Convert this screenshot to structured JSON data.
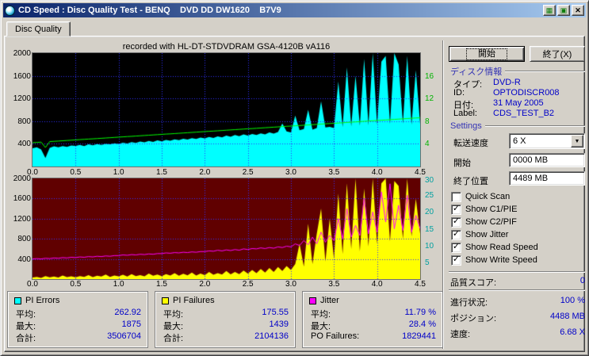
{
  "window": {
    "title": "CD Speed : Disc Quality Test - BENQ    DVD DD DW1620    B7V9",
    "buttons": [
      {
        "name": "grid-icon",
        "glyph": "▦"
      },
      {
        "name": "disc-icon",
        "glyph": "▣"
      },
      {
        "name": "close-icon",
        "glyph": "✕"
      }
    ]
  },
  "tabs": {
    "disc_quality": "Disc Quality"
  },
  "colors": {
    "window_bg": "#d4d0c8",
    "titlebar_left": "#0a246a",
    "titlebar_right": "#a6caf0",
    "value": "#0000c8",
    "header": "#3434b4"
  },
  "buttons": {
    "start": "開始",
    "exit": "終了(X)"
  },
  "disc_info": {
    "header": "ディスク情報",
    "type_label": "タイプ:",
    "type": "DVD-R",
    "id_label": "ID:",
    "id": "OPTODISCR008",
    "date_label": "日付:",
    "date": "31 May 2005",
    "label_label": "Label:",
    "label": "CDS_TEST_B2"
  },
  "settings": {
    "header": "Settings",
    "speed_label": "転送速度",
    "speed_value": "6 X",
    "start_label": "開始",
    "start_value": "0000 MB",
    "end_label": "終了位置",
    "end_value": "4489 MB",
    "checkboxes": [
      {
        "label": "Quick Scan",
        "checked": false
      },
      {
        "label": "Show C1/PIE",
        "checked": true
      },
      {
        "label": "Show C2/PIF",
        "checked": true
      },
      {
        "label": "Show Jitter",
        "checked": true
      },
      {
        "label": "Show Read Speed",
        "checked": true
      },
      {
        "label": "Show Write Speed",
        "checked": true
      }
    ]
  },
  "quality": {
    "label": "品質スコア:",
    "value": "0"
  },
  "progress": {
    "label": "進行状況:",
    "value": "100 %",
    "position_label": "ポジション:",
    "position": "4488 MB",
    "speed_label": "速度:",
    "speed": "6.68 X"
  },
  "stats": [
    {
      "title": "PI Errors",
      "swatch": "#00ffff",
      "rows": [
        [
          "平均:",
          "262.92"
        ],
        [
          "最大:",
          "1875"
        ],
        [
          "合計:",
          "3506704"
        ]
      ]
    },
    {
      "title": "PI Failures",
      "swatch": "#ffff00",
      "rows": [
        [
          "平均:",
          "175.55"
        ],
        [
          "最大:",
          "1439"
        ],
        [
          "合計:",
          "2104136"
        ]
      ]
    },
    {
      "title": "Jitter",
      "swatch": "#ff00ff",
      "rows": [
        [
          "平均:",
          "11.79 %"
        ],
        [
          "最大:",
          "28.4 %"
        ],
        [
          "PO Failures:",
          "1829441"
        ]
      ]
    }
  ],
  "chart_data": [
    {
      "type": "area",
      "title": "recorded with HL-DT-STDVDRAM GSA-4120B vA116",
      "x_start": 0,
      "x_step": 0.05,
      "xlim": [
        0,
        4.5
      ],
      "x_ticks": [
        "0.0",
        "0.5",
        "1.0",
        "1.5",
        "2.0",
        "2.5",
        "3.0",
        "3.5",
        "4.0",
        "4.5"
      ],
      "ylim": [
        0,
        2000
      ],
      "y_ticks": [
        2000,
        1600,
        1200,
        800,
        400
      ],
      "right_axis": {
        "max": 20,
        "ticks": [
          16,
          12,
          8,
          4
        ],
        "color": "#00b400"
      },
      "bg": "#000000",
      "grid_color": "#3030ff",
      "series": [
        {
          "name": "PI Errors",
          "type": "area",
          "axis": "left",
          "color": "#00ffff",
          "values": [
            320,
            340,
            300,
            150,
            330,
            355,
            340,
            360,
            345,
            370,
            365,
            380,
            360,
            390,
            375,
            395,
            380,
            400,
            390,
            410,
            400,
            420,
            405,
            430,
            415,
            440,
            425,
            450,
            435,
            460,
            445,
            470,
            455,
            480,
            465,
            490,
            475,
            500,
            485,
            510,
            495,
            520,
            505,
            530,
            515,
            545,
            525,
            555,
            535,
            565,
            545,
            575,
            555,
            585,
            565,
            600,
            580,
            610,
            760,
            620,
            600,
            900,
            640,
            660,
            1000,
            650,
            680,
            1150,
            690,
            700,
            680,
            1500,
            700,
            1750,
            710,
            1600,
            720,
            1900,
            730,
            2000,
            740,
            1850,
            1950,
            750,
            2000,
            1800,
            760,
            1950,
            740,
            1700,
            750
          ]
        },
        {
          "name": "Read Speed",
          "type": "line",
          "axis": "right",
          "color": "#00ff00",
          "values": [
            4.2,
            4.25,
            4.3,
            3.35,
            4.4,
            4.44,
            4.49,
            4.54,
            4.59,
            4.64,
            4.69,
            4.74,
            4.79,
            4.84,
            4.88,
            4.93,
            4.98,
            5.03,
            5.08,
            5.13,
            5.18,
            5.23,
            5.28,
            5.32,
            5.37,
            5.42,
            5.47,
            5.52,
            5.57,
            5.62,
            5.67,
            5.72,
            5.76,
            5.81,
            5.86,
            5.91,
            5.96,
            6.01,
            6.06,
            6.11,
            6.16,
            6.21,
            6.25,
            6.3,
            6.35,
            6.4,
            6.45,
            6.5,
            6.55,
            6.6,
            6.65,
            6.69,
            6.74,
            6.79,
            6.84,
            6.89,
            6.94,
            6.99,
            7.04,
            7.09,
            7.13,
            7.18,
            7.23,
            7.28,
            7.33,
            7.38,
            7.43,
            7.48,
            7.53,
            7.58,
            7.62,
            7.67,
            7.72,
            7.77,
            7.82,
            7.87,
            7.92,
            7.97,
            8.02,
            8.07,
            8.11,
            8.16,
            8.21,
            8.26,
            8.31,
            8.36,
            8.41,
            8.46,
            8.51,
            8.56,
            8.6
          ]
        }
      ]
    },
    {
      "type": "area",
      "title": "",
      "x_start": 0,
      "x_step": 0.05,
      "xlim": [
        0,
        4.5
      ],
      "x_ticks": [
        "0.0",
        "0.5",
        "1.0",
        "1.5",
        "2.0",
        "2.5",
        "3.0",
        "3.5",
        "4.0",
        "4.5"
      ],
      "ylim": [
        0,
        2000
      ],
      "y_ticks": [
        2000,
        1600,
        1200,
        800,
        400
      ],
      "right_axis": {
        "max": 30,
        "ticks": [
          30,
          25,
          20,
          15,
          10,
          5
        ],
        "color": "#00a0a0"
      },
      "bg": "#600000",
      "grid_color": "#3030ff",
      "series": [
        {
          "name": "PI Failures",
          "type": "area",
          "axis": "left",
          "color": "#ffff00",
          "values": [
            30,
            45,
            25,
            60,
            35,
            50,
            30,
            70,
            40,
            55,
            35,
            60,
            45,
            80,
            40,
            65,
            50,
            90,
            45,
            70,
            55,
            85,
            50,
            100,
            60,
            80,
            55,
            110,
            65,
            90,
            60,
            100,
            70,
            120,
            65,
            105,
            75,
            130,
            70,
            110,
            80,
            140,
            85,
            120,
            90,
            160,
            95,
            140,
            100,
            170,
            110,
            180,
            120,
            200,
            130,
            220,
            140,
            240,
            160,
            260,
            180,
            300,
            700,
            250,
            1100,
            300,
            900,
            1400,
            350,
            1200,
            400,
            1700,
            500,
            1900,
            600,
            2000,
            550,
            1800,
            650,
            2000,
            700,
            1900,
            2000,
            750,
            1950,
            1850,
            800,
            2000,
            850,
            1600,
            900
          ]
        },
        {
          "name": "Jitter",
          "type": "line",
          "axis": "right",
          "color": "#ff00ff",
          "values": [
            6,
            6.1,
            6,
            6.2,
            6.1,
            6.3,
            6.2,
            6.4,
            6.3,
            6.5,
            6.4,
            6.6,
            6.5,
            6.7,
            6.6,
            6.8,
            6.7,
            6.9,
            6.8,
            7,
            7,
            7.2,
            7.1,
            7.3,
            7.2,
            7.4,
            7.3,
            7.5,
            7.4,
            7.6,
            7.6,
            7.8,
            7.7,
            7.9,
            7.8,
            8,
            7.9,
            8.1,
            8,
            8.2,
            8.2,
            8.4,
            8.3,
            8.6,
            8.4,
            8.7,
            8.5,
            8.8,
            8.6,
            9,
            8.8,
            9.1,
            9,
            9.3,
            9.1,
            9.4,
            9.2,
            9.6,
            9.4,
            9.8,
            9.6,
            10.5,
            10,
            11.5,
            10.2,
            12.5,
            10.5,
            14,
            11,
            13,
            11.5,
            18,
            12,
            21,
            12.5,
            16,
            13,
            24,
            13.5,
            20,
            14,
            26,
            17,
            28.4,
            15,
            22,
            14.5,
            25,
            14,
            19,
            15
          ]
        }
      ]
    }
  ]
}
